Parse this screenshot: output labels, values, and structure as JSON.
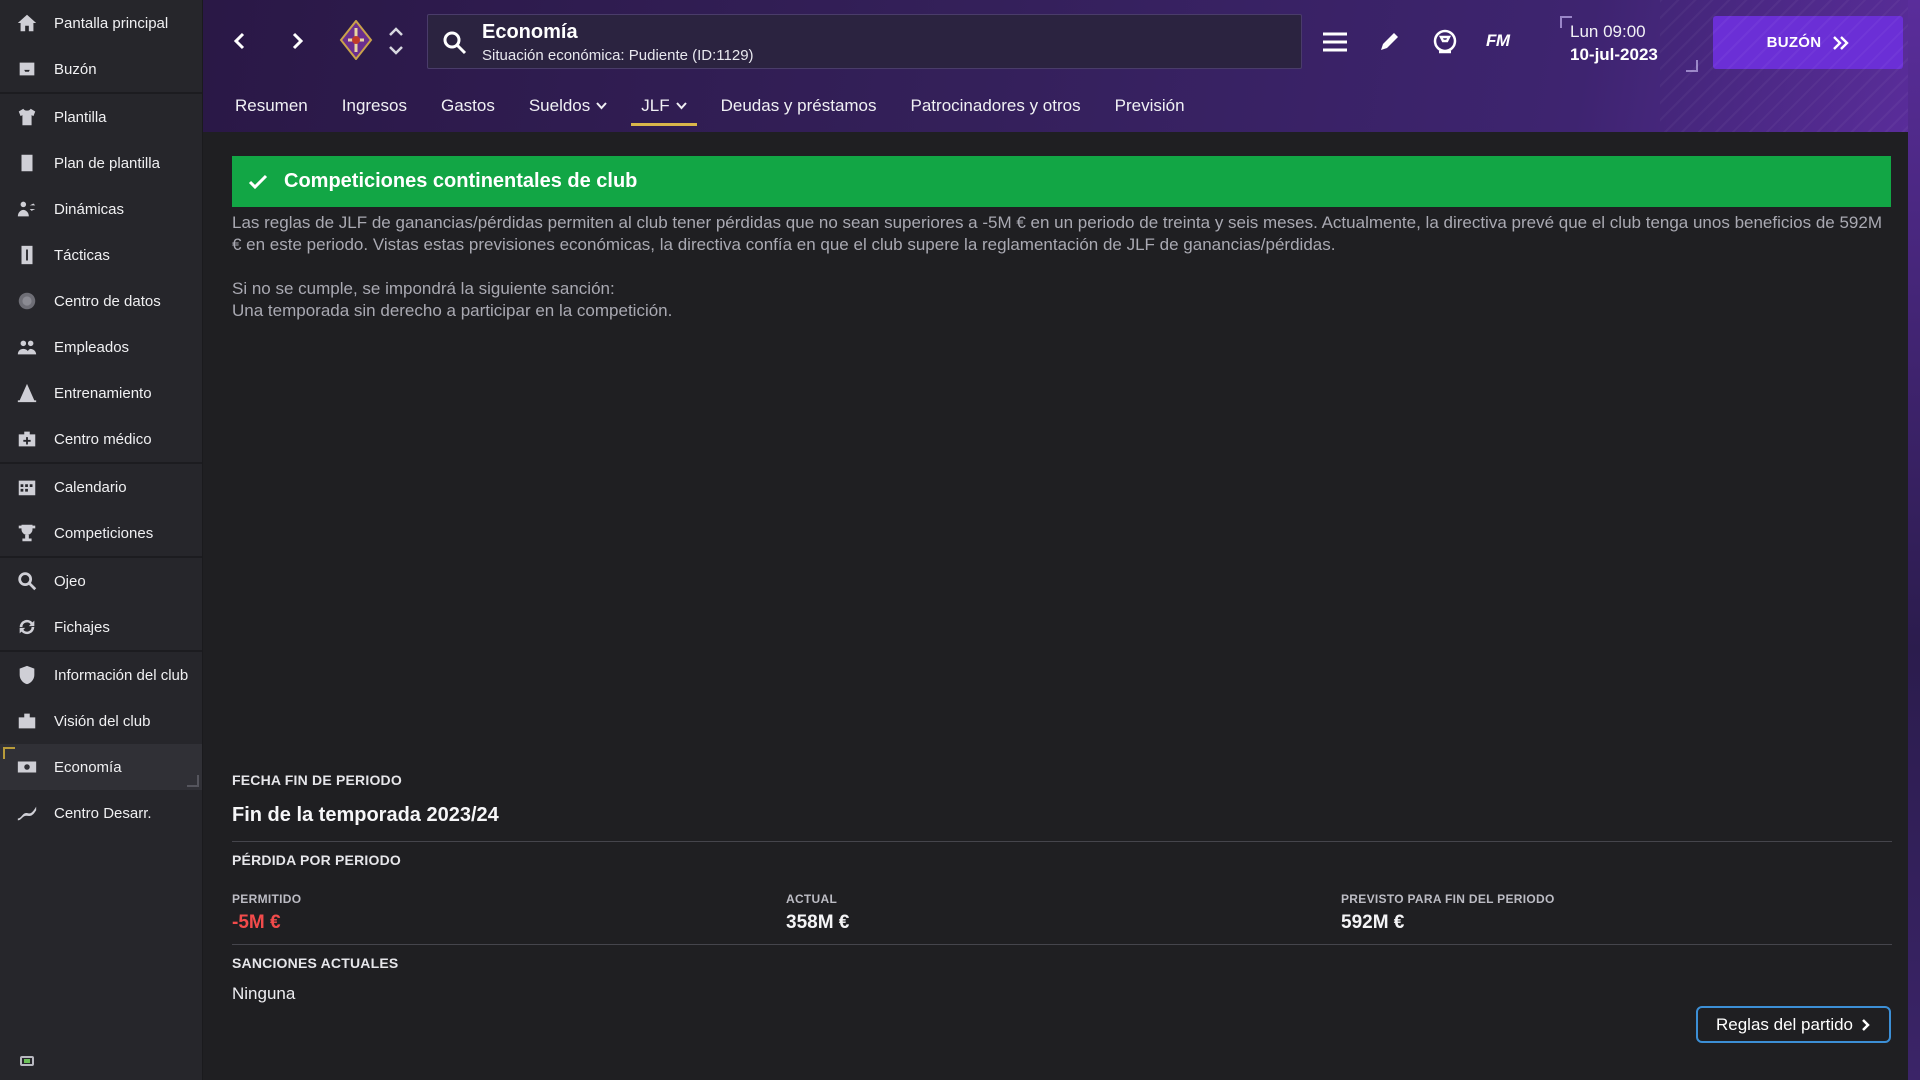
{
  "sidebar": {
    "items": [
      {
        "label": "Pantalla principal",
        "icon": "home-icon"
      },
      {
        "label": "Buzón",
        "icon": "inbox-icon"
      },
      {
        "label": "Plantilla",
        "icon": "shirt-icon"
      },
      {
        "label": "Plan de plantilla",
        "icon": "clipboard-icon"
      },
      {
        "label": "Dinámicas",
        "icon": "people-dynamics-icon"
      },
      {
        "label": "Tácticas",
        "icon": "tactics-board-icon"
      },
      {
        "label": "Centro de datos",
        "icon": "data-hub-icon"
      },
      {
        "label": "Empleados",
        "icon": "staff-icon"
      },
      {
        "label": "Entrenamiento",
        "icon": "training-cone-icon"
      },
      {
        "label": "Centro médico",
        "icon": "medical-kit-icon"
      },
      {
        "label": "Calendario",
        "icon": "calendar-icon"
      },
      {
        "label": "Competiciones",
        "icon": "trophy-icon"
      },
      {
        "label": "Ojeo",
        "icon": "scouting-magnifier-icon"
      },
      {
        "label": "Fichajes",
        "icon": "transfers-arrows-icon"
      },
      {
        "label": "Información del club",
        "icon": "club-shield-icon"
      },
      {
        "label": "Visión del club",
        "icon": "briefcase-icon"
      },
      {
        "label": "Economía",
        "icon": "money-icon"
      },
      {
        "label": "Centro Desarr.",
        "icon": "development-chart-icon"
      }
    ],
    "active": "Economía"
  },
  "header": {
    "title": "Economía",
    "subtitle": "Situación económica: Pudiente (ID:1129)",
    "time": "Lun 09:00",
    "date": "10-jul-2023",
    "logo_text": "FM",
    "inbox_button": "BUZÓN"
  },
  "tabs": [
    {
      "label": "Resumen",
      "dropdown": false
    },
    {
      "label": "Ingresos",
      "dropdown": false
    },
    {
      "label": "Gastos",
      "dropdown": false
    },
    {
      "label": "Sueldos",
      "dropdown": true
    },
    {
      "label": "JLF",
      "dropdown": true,
      "active": true
    },
    {
      "label": "Deudas y préstamos",
      "dropdown": false
    },
    {
      "label": "Patrocinadores y otros",
      "dropdown": false
    },
    {
      "label": "Previsión",
      "dropdown": false
    }
  ],
  "main": {
    "banner_title": "Competiciones continentales de club",
    "description_1": "Las reglas de JLF de ganancias/pérdidas permiten al club tener pérdidas que no sean superiores a -5M € en un periodo de treinta y seis meses. Actualmente, la directiva prevé que el club tenga unos beneficios de 592M € en este periodo. Vistas estas previsiones económicas, la directiva confía en que el club supere la reglamentación de JLF de ganancias/pérdidas.",
    "description_2a": "Si no se cumple, se impondrá la siguiente sanción:",
    "description_2b": "Una temporada sin derecho a participar en la competición.",
    "period_end_label": "FECHA FIN DE PERIODO",
    "period_end_value": "Fin de la temporada 2023/24",
    "loss_label": "PÉRDIDA POR PERIODO",
    "allowed_label": "PERMITIDO",
    "allowed_value": "-5M €",
    "current_label": "ACTUAL",
    "current_value": "358M €",
    "forecast_label": "PREVISTO PARA FIN DEL PERIODO",
    "forecast_value": "592M €",
    "sanctions_label": "SANCIONES ACTUALES",
    "sanctions_value": "Ninguna",
    "rules_button": "Reglas del partido"
  },
  "colors": {
    "accent_purple": "#6b2fd6",
    "success_green": "#12a645",
    "negative_red": "#f24b4b",
    "tab_underline": "#d9b64a",
    "rules_border": "#3c8fd6"
  }
}
